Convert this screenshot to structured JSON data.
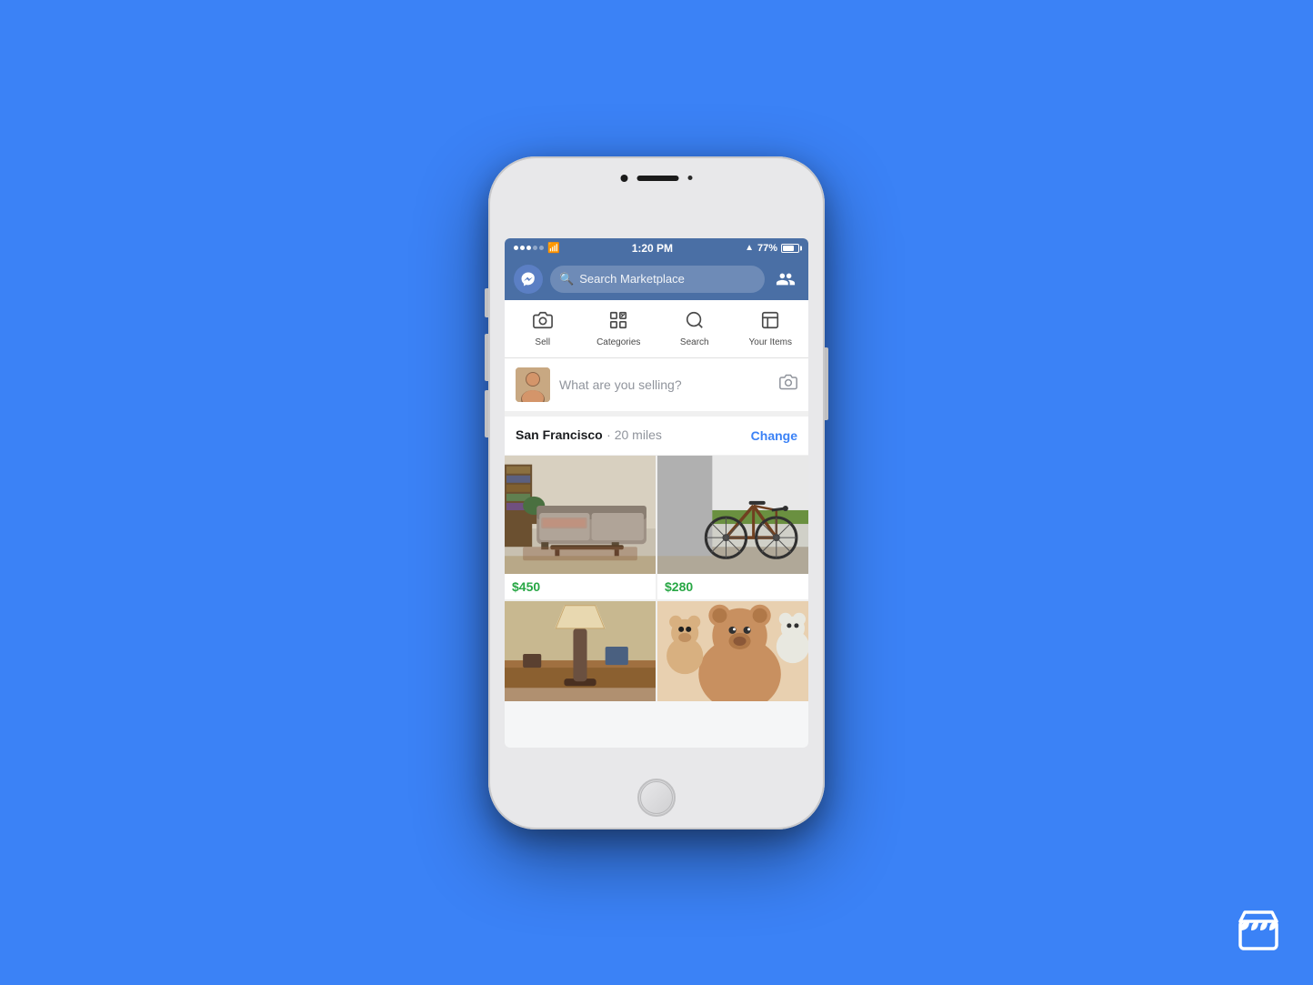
{
  "background": {
    "color": "#3b82f6"
  },
  "statusBar": {
    "signal": "•••○○",
    "wifi": "wifi",
    "time": "1:20 PM",
    "bluetooth": "bluetooth",
    "battery_pct": "77%"
  },
  "navBar": {
    "searchPlaceholder": "Search Marketplace",
    "messengerIcon": "messenger",
    "profileIcon": "profile"
  },
  "bottomNav": {
    "items": [
      {
        "label": "Sell",
        "icon": "camera"
      },
      {
        "label": "Categories",
        "icon": "star-grid"
      },
      {
        "label": "Search",
        "icon": "magnify"
      },
      {
        "label": "Your Items",
        "icon": "store-box"
      }
    ]
  },
  "sellBar": {
    "placeholder": "What are you selling?",
    "cameraIcon": "camera"
  },
  "locationBar": {
    "city": "San Francisco",
    "distance": "20 miles",
    "changeLabel": "Change"
  },
  "listings": [
    {
      "type": "sofa",
      "price": "$450",
      "col": 0
    },
    {
      "type": "bike",
      "price": "$280",
      "col": 1
    },
    {
      "type": "lamp",
      "price": "",
      "col": 0
    },
    {
      "type": "bears",
      "price": "",
      "col": 1
    }
  ],
  "cornerIcon": {
    "label": "marketplace-store"
  }
}
